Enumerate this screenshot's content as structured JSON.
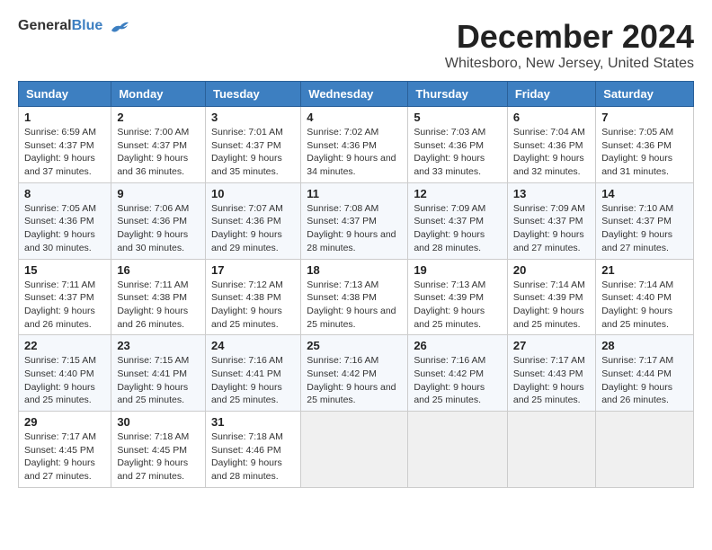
{
  "header": {
    "logo_general": "General",
    "logo_blue": "Blue",
    "title": "December 2024",
    "subtitle": "Whitesboro, New Jersey, United States"
  },
  "weekdays": [
    "Sunday",
    "Monday",
    "Tuesday",
    "Wednesday",
    "Thursday",
    "Friday",
    "Saturday"
  ],
  "weeks": [
    [
      {
        "day": "1",
        "sunrise": "Sunrise: 6:59 AM",
        "sunset": "Sunset: 4:37 PM",
        "daylight": "Daylight: 9 hours and 37 minutes."
      },
      {
        "day": "2",
        "sunrise": "Sunrise: 7:00 AM",
        "sunset": "Sunset: 4:37 PM",
        "daylight": "Daylight: 9 hours and 36 minutes."
      },
      {
        "day": "3",
        "sunrise": "Sunrise: 7:01 AM",
        "sunset": "Sunset: 4:37 PM",
        "daylight": "Daylight: 9 hours and 35 minutes."
      },
      {
        "day": "4",
        "sunrise": "Sunrise: 7:02 AM",
        "sunset": "Sunset: 4:36 PM",
        "daylight": "Daylight: 9 hours and 34 minutes."
      },
      {
        "day": "5",
        "sunrise": "Sunrise: 7:03 AM",
        "sunset": "Sunset: 4:36 PM",
        "daylight": "Daylight: 9 hours and 33 minutes."
      },
      {
        "day": "6",
        "sunrise": "Sunrise: 7:04 AM",
        "sunset": "Sunset: 4:36 PM",
        "daylight": "Daylight: 9 hours and 32 minutes."
      },
      {
        "day": "7",
        "sunrise": "Sunrise: 7:05 AM",
        "sunset": "Sunset: 4:36 PM",
        "daylight": "Daylight: 9 hours and 31 minutes."
      }
    ],
    [
      {
        "day": "8",
        "sunrise": "Sunrise: 7:05 AM",
        "sunset": "Sunset: 4:36 PM",
        "daylight": "Daylight: 9 hours and 30 minutes."
      },
      {
        "day": "9",
        "sunrise": "Sunrise: 7:06 AM",
        "sunset": "Sunset: 4:36 PM",
        "daylight": "Daylight: 9 hours and 30 minutes."
      },
      {
        "day": "10",
        "sunrise": "Sunrise: 7:07 AM",
        "sunset": "Sunset: 4:36 PM",
        "daylight": "Daylight: 9 hours and 29 minutes."
      },
      {
        "day": "11",
        "sunrise": "Sunrise: 7:08 AM",
        "sunset": "Sunset: 4:37 PM",
        "daylight": "Daylight: 9 hours and 28 minutes."
      },
      {
        "day": "12",
        "sunrise": "Sunrise: 7:09 AM",
        "sunset": "Sunset: 4:37 PM",
        "daylight": "Daylight: 9 hours and 28 minutes."
      },
      {
        "day": "13",
        "sunrise": "Sunrise: 7:09 AM",
        "sunset": "Sunset: 4:37 PM",
        "daylight": "Daylight: 9 hours and 27 minutes."
      },
      {
        "day": "14",
        "sunrise": "Sunrise: 7:10 AM",
        "sunset": "Sunset: 4:37 PM",
        "daylight": "Daylight: 9 hours and 27 minutes."
      }
    ],
    [
      {
        "day": "15",
        "sunrise": "Sunrise: 7:11 AM",
        "sunset": "Sunset: 4:37 PM",
        "daylight": "Daylight: 9 hours and 26 minutes."
      },
      {
        "day": "16",
        "sunrise": "Sunrise: 7:11 AM",
        "sunset": "Sunset: 4:38 PM",
        "daylight": "Daylight: 9 hours and 26 minutes."
      },
      {
        "day": "17",
        "sunrise": "Sunrise: 7:12 AM",
        "sunset": "Sunset: 4:38 PM",
        "daylight": "Daylight: 9 hours and 25 minutes."
      },
      {
        "day": "18",
        "sunrise": "Sunrise: 7:13 AM",
        "sunset": "Sunset: 4:38 PM",
        "daylight": "Daylight: 9 hours and 25 minutes."
      },
      {
        "day": "19",
        "sunrise": "Sunrise: 7:13 AM",
        "sunset": "Sunset: 4:39 PM",
        "daylight": "Daylight: 9 hours and 25 minutes."
      },
      {
        "day": "20",
        "sunrise": "Sunrise: 7:14 AM",
        "sunset": "Sunset: 4:39 PM",
        "daylight": "Daylight: 9 hours and 25 minutes."
      },
      {
        "day": "21",
        "sunrise": "Sunrise: 7:14 AM",
        "sunset": "Sunset: 4:40 PM",
        "daylight": "Daylight: 9 hours and 25 minutes."
      }
    ],
    [
      {
        "day": "22",
        "sunrise": "Sunrise: 7:15 AM",
        "sunset": "Sunset: 4:40 PM",
        "daylight": "Daylight: 9 hours and 25 minutes."
      },
      {
        "day": "23",
        "sunrise": "Sunrise: 7:15 AM",
        "sunset": "Sunset: 4:41 PM",
        "daylight": "Daylight: 9 hours and 25 minutes."
      },
      {
        "day": "24",
        "sunrise": "Sunrise: 7:16 AM",
        "sunset": "Sunset: 4:41 PM",
        "daylight": "Daylight: 9 hours and 25 minutes."
      },
      {
        "day": "25",
        "sunrise": "Sunrise: 7:16 AM",
        "sunset": "Sunset: 4:42 PM",
        "daylight": "Daylight: 9 hours and 25 minutes."
      },
      {
        "day": "26",
        "sunrise": "Sunrise: 7:16 AM",
        "sunset": "Sunset: 4:42 PM",
        "daylight": "Daylight: 9 hours and 25 minutes."
      },
      {
        "day": "27",
        "sunrise": "Sunrise: 7:17 AM",
        "sunset": "Sunset: 4:43 PM",
        "daylight": "Daylight: 9 hours and 25 minutes."
      },
      {
        "day": "28",
        "sunrise": "Sunrise: 7:17 AM",
        "sunset": "Sunset: 4:44 PM",
        "daylight": "Daylight: 9 hours and 26 minutes."
      }
    ],
    [
      {
        "day": "29",
        "sunrise": "Sunrise: 7:17 AM",
        "sunset": "Sunset: 4:45 PM",
        "daylight": "Daylight: 9 hours and 27 minutes."
      },
      {
        "day": "30",
        "sunrise": "Sunrise: 7:18 AM",
        "sunset": "Sunset: 4:45 PM",
        "daylight": "Daylight: 9 hours and 27 minutes."
      },
      {
        "day": "31",
        "sunrise": "Sunrise: 7:18 AM",
        "sunset": "Sunset: 4:46 PM",
        "daylight": "Daylight: 9 hours and 28 minutes."
      },
      null,
      null,
      null,
      null
    ]
  ]
}
